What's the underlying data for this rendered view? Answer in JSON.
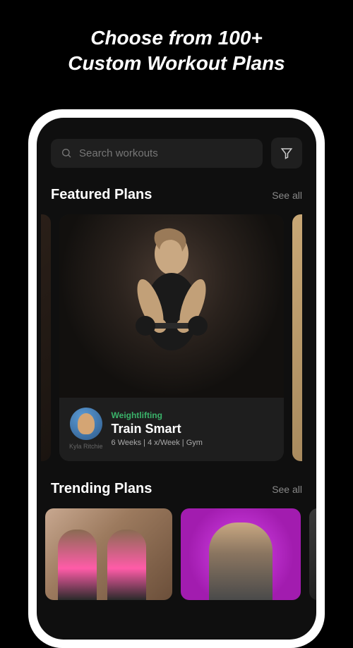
{
  "marketing": {
    "headline_line1": "Choose from 100+",
    "headline_line2": "Custom Workout Plans"
  },
  "search": {
    "placeholder": "Search workouts"
  },
  "sections": {
    "featured": {
      "title": "Featured Plans",
      "see_all": "See all"
    },
    "trending": {
      "title": "Trending Plans",
      "see_all": "See all"
    }
  },
  "featured_plan": {
    "category": "Weightlifting",
    "title": "Train Smart",
    "details": "6 Weeks | 4 x/Week | Gym",
    "author": "Kyla Ritchie"
  }
}
